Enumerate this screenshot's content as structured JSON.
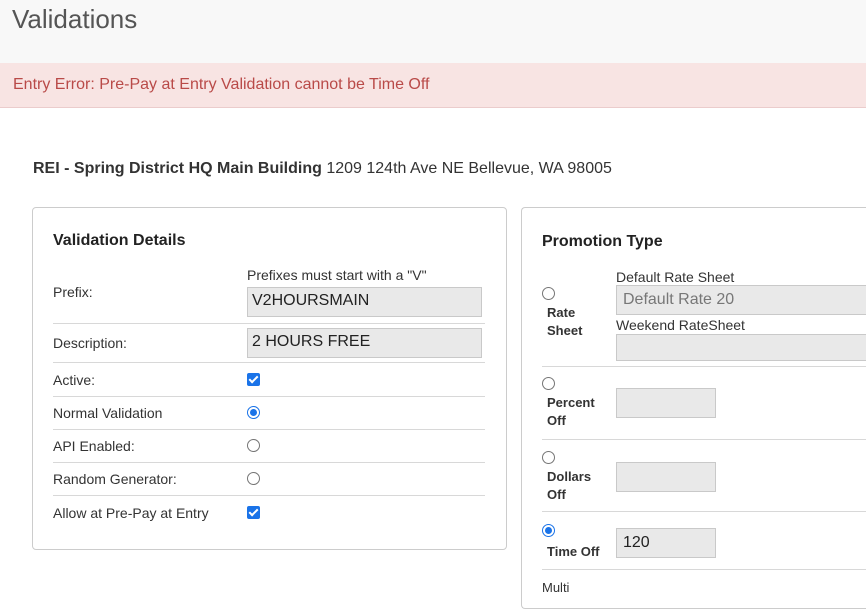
{
  "page": {
    "title": "Validations"
  },
  "alert": {
    "message": "Entry Error: Pre-Pay at Entry Validation cannot be Time Off"
  },
  "location": {
    "name": "REI - Spring District HQ Main Building",
    "address": "1209 124th Ave NE Bellevue,  WA  98005"
  },
  "validation_details": {
    "title": "Validation Details",
    "prefix": {
      "label": "Prefix:",
      "note": "Prefixes must start with a \"V\"",
      "value": "V2HOURSMAIN"
    },
    "description": {
      "label": "Description:",
      "value": "2 HOURS FREE"
    },
    "active": {
      "label": "Active:",
      "checked": true
    },
    "normal_validation": {
      "label": "Normal Validation",
      "selected": true
    },
    "api_enabled": {
      "label": "API Enabled:",
      "selected": false
    },
    "random_generator": {
      "label": "Random Generator:",
      "selected": false
    },
    "allow_prepay": {
      "label": "Allow at Pre-Pay at Entry",
      "checked": true
    }
  },
  "promotion_type": {
    "title": "Promotion Type",
    "rate_sheet": {
      "label_line1": "Rate",
      "label_line2": "Sheet",
      "selected": false,
      "default_label": "Default Rate Sheet",
      "default_value": "Default Rate 20",
      "weekend_label": "Weekend RateSheet",
      "weekend_value": ""
    },
    "percent_off": {
      "label_line1": "Percent",
      "label_line2": "Off",
      "selected": false,
      "value": ""
    },
    "dollars_off": {
      "label_line1": "Dollars",
      "label_line2": "Off",
      "selected": false,
      "value": ""
    },
    "time_off": {
      "label": "Time Off",
      "selected": true,
      "value": "120"
    },
    "multi": {
      "label": "Multi"
    }
  },
  "colors": {
    "accent": "#1a73e8",
    "error_text": "#b94a48",
    "error_bg": "#f8e4e3"
  }
}
